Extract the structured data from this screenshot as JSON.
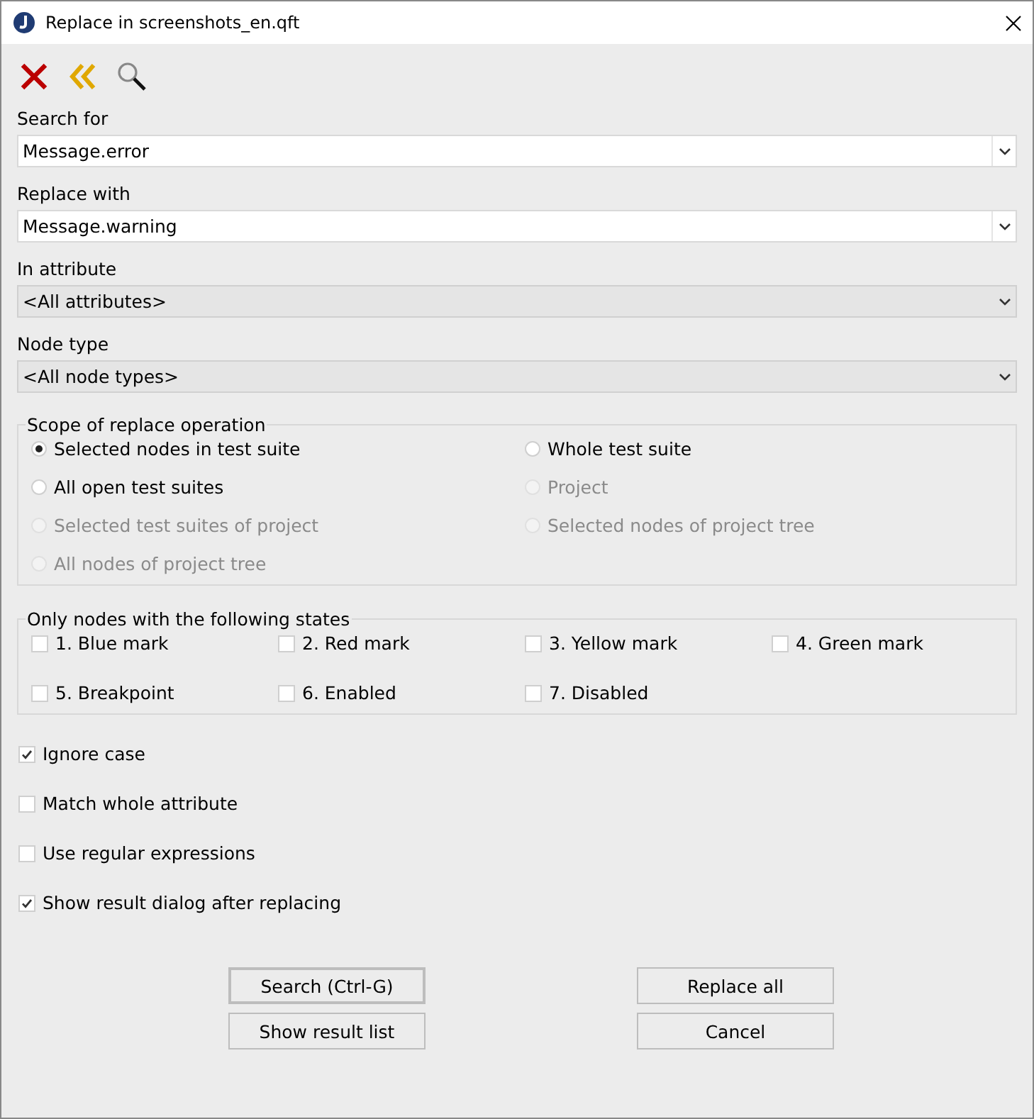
{
  "window": {
    "title": "Replace in screenshots_en.qft"
  },
  "toolbar": [
    {
      "kind": "close"
    },
    {
      "kind": "back"
    },
    {
      "kind": "search"
    }
  ],
  "fields": [
    {
      "label": "Search for",
      "kind": "editable",
      "value": "Message.error"
    },
    {
      "label": "Replace with",
      "kind": "editable",
      "value": "Message.warning"
    },
    {
      "label": "In attribute",
      "kind": "select",
      "value": "<All attributes>"
    },
    {
      "label": "Node type",
      "kind": "select",
      "value": "<All node types>"
    }
  ],
  "scope": {
    "title": "Scope of replace operation",
    "options": [
      {
        "label": "Selected nodes in test suite",
        "selected": true,
        "disabled": false
      },
      {
        "label": "Whole test suite",
        "selected": false,
        "disabled": false
      },
      {
        "label": "All open test suites",
        "selected": false,
        "disabled": false
      },
      {
        "label": "Project",
        "selected": false,
        "disabled": true
      },
      {
        "label": "Selected test suites of project",
        "selected": false,
        "disabled": true
      },
      {
        "label": "Selected nodes of project tree",
        "selected": false,
        "disabled": true
      },
      {
        "label": "All nodes of project tree",
        "selected": false,
        "disabled": true
      }
    ]
  },
  "states": {
    "title": "Only nodes with the following states",
    "items": [
      {
        "label": "1. Blue mark",
        "checked": false
      },
      {
        "label": "2. Red mark",
        "checked": false
      },
      {
        "label": "3. Yellow mark",
        "checked": false
      },
      {
        "label": "4. Green mark",
        "checked": false
      },
      {
        "label": "5. Breakpoint",
        "checked": false
      },
      {
        "label": "6. Enabled",
        "checked": false
      },
      {
        "label": "7. Disabled",
        "checked": false
      }
    ]
  },
  "options": [
    {
      "label": "Ignore case",
      "checked": true
    },
    {
      "label": "Match whole attribute",
      "checked": false
    },
    {
      "label": "Use regular expressions",
      "checked": false
    },
    {
      "label": "Show result dialog after replacing",
      "checked": true
    }
  ],
  "buttons": [
    {
      "label": "Search (Ctrl-G)",
      "default": true
    },
    {
      "label": "Replace all",
      "default": false
    },
    {
      "label": "Show result list",
      "default": false
    },
    {
      "label": "Cancel",
      "default": false
    }
  ]
}
